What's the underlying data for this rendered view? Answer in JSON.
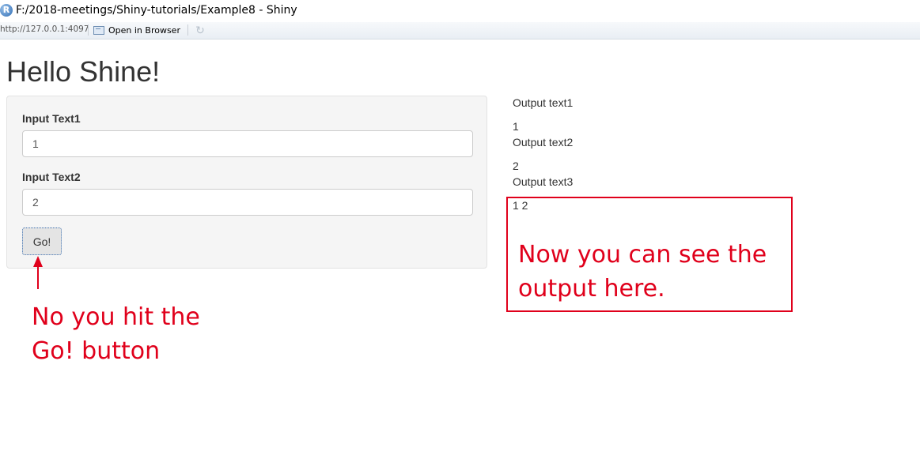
{
  "window": {
    "title": "F:/2018-meetings/Shiny-tutorials/Example8 - Shiny",
    "app_icon_letter": "R"
  },
  "toolbar": {
    "url": "http://127.0.0.1:4097",
    "open_in_browser_label": "Open in Browser",
    "refresh_icon": "refresh-icon"
  },
  "app": {
    "title": "Hello Shine!",
    "inputs": [
      {
        "label": "Input Text1",
        "value": "1"
      },
      {
        "label": "Input Text2",
        "value": "2"
      }
    ],
    "go_button_label": "Go!",
    "outputs": [
      {
        "label": "Output text1",
        "value": "1"
      },
      {
        "label": "Output text2",
        "value": "2"
      },
      {
        "label": "Output text3",
        "value": "1 2"
      }
    ]
  },
  "annotations": {
    "left_line1": "No you hit the",
    "left_line2": "Go! button",
    "right_line1": "Now you can see the",
    "right_line2": "output here.",
    "color": "#e0001b"
  }
}
